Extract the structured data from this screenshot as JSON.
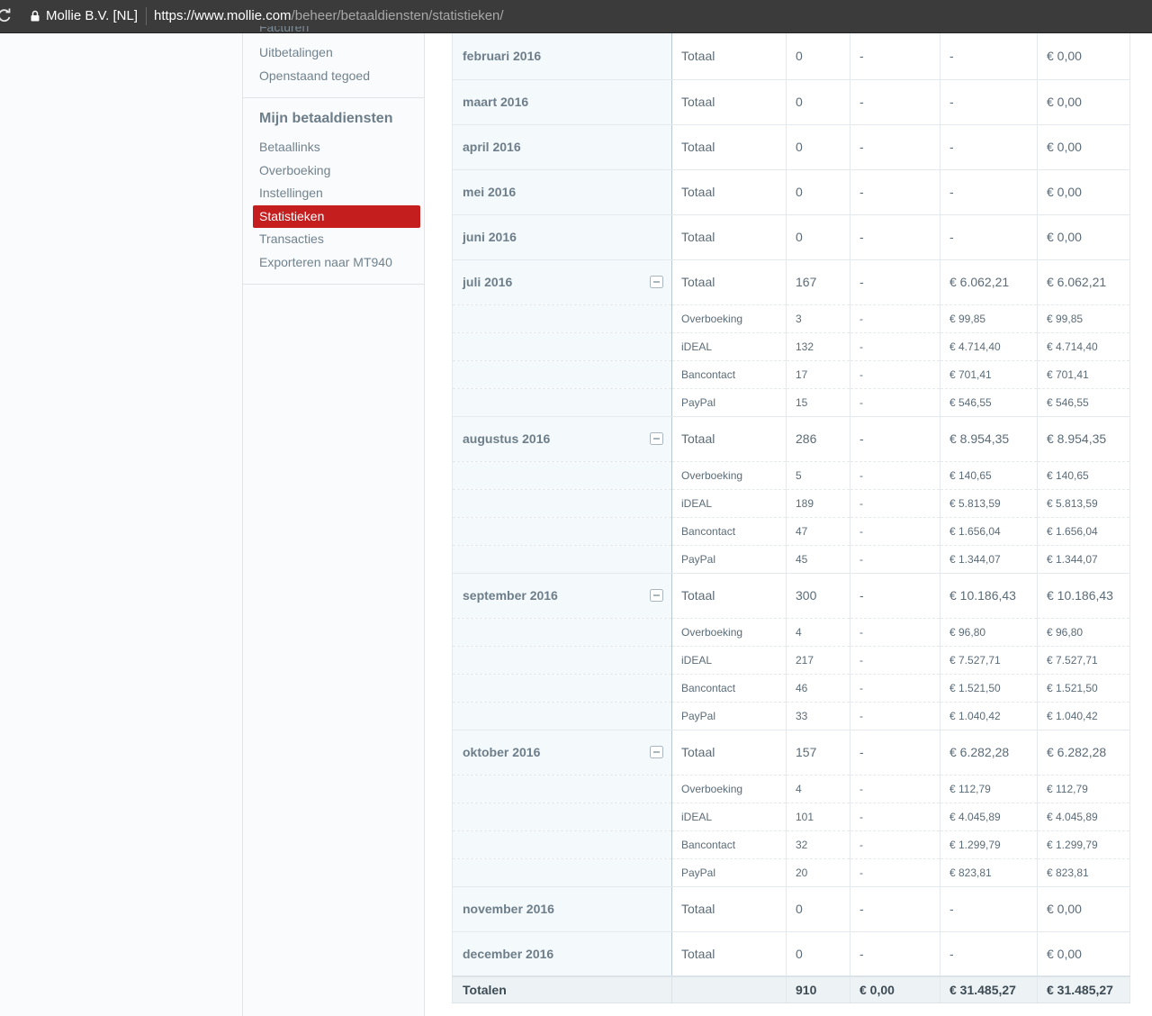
{
  "browser": {
    "site_identity": "Mollie B.V. [NL]",
    "url_scheme": "https://",
    "url_host": "www.mollie.com",
    "url_path": "/beheer/betaaldiensten/statistieken/"
  },
  "sidebar": {
    "clipped_item": "Facturen",
    "top_items": [
      {
        "label": "Uitbetalingen"
      },
      {
        "label": "Openstaand tegoed"
      }
    ],
    "section_heading": "Mijn betaaldiensten",
    "items": [
      {
        "label": "Betaallinks"
      },
      {
        "label": "Overboeking"
      },
      {
        "label": "Instellingen"
      },
      {
        "label": "Statistieken",
        "active": true
      },
      {
        "label": "Transacties"
      },
      {
        "label": "Exporteren naar MT940"
      }
    ]
  },
  "table": {
    "rows": [
      {
        "month": "februari 2016",
        "label": "Totaal",
        "count": "0",
        "extra": "-",
        "amount": "-",
        "total": "€ 0,00"
      },
      {
        "month": "maart 2016",
        "label": "Totaal",
        "count": "0",
        "extra": "-",
        "amount": "-",
        "total": "€ 0,00"
      },
      {
        "month": "april 2016",
        "label": "Totaal",
        "count": "0",
        "extra": "-",
        "amount": "-",
        "total": "€ 0,00"
      },
      {
        "month": "mei 2016",
        "label": "Totaal",
        "count": "0",
        "extra": "-",
        "amount": "-",
        "total": "€ 0,00"
      },
      {
        "month": "juni 2016",
        "label": "Totaal",
        "count": "0",
        "extra": "-",
        "amount": "-",
        "total": "€ 0,00"
      },
      {
        "month": "juli 2016",
        "label": "Totaal",
        "count": "167",
        "extra": "-",
        "amount": "€ 6.062,21",
        "total": "€ 6.062,21",
        "methods": [
          {
            "label": "Overboeking",
            "count": "3",
            "extra": "-",
            "amount": "€ 99,85",
            "total": "€ 99,85"
          },
          {
            "label": "iDEAL",
            "count": "132",
            "extra": "-",
            "amount": "€ 4.714,40",
            "total": "€ 4.714,40"
          },
          {
            "label": "Bancontact",
            "count": "17",
            "extra": "-",
            "amount": "€ 701,41",
            "total": "€ 701,41"
          },
          {
            "label": "PayPal",
            "count": "15",
            "extra": "-",
            "amount": "€ 546,55",
            "total": "€ 546,55"
          }
        ]
      },
      {
        "month": "augustus 2016",
        "label": "Totaal",
        "count": "286",
        "extra": "-",
        "amount": "€ 8.954,35",
        "total": "€ 8.954,35",
        "methods": [
          {
            "label": "Overboeking",
            "count": "5",
            "extra": "-",
            "amount": "€ 140,65",
            "total": "€ 140,65"
          },
          {
            "label": "iDEAL",
            "count": "189",
            "extra": "-",
            "amount": "€ 5.813,59",
            "total": "€ 5.813,59"
          },
          {
            "label": "Bancontact",
            "count": "47",
            "extra": "-",
            "amount": "€ 1.656,04",
            "total": "€ 1.656,04"
          },
          {
            "label": "PayPal",
            "count": "45",
            "extra": "-",
            "amount": "€ 1.344,07",
            "total": "€ 1.344,07"
          }
        ]
      },
      {
        "month": "september 2016",
        "label": "Totaal",
        "count": "300",
        "extra": "-",
        "amount": "€ 10.186,43",
        "total": "€ 10.186,43",
        "methods": [
          {
            "label": "Overboeking",
            "count": "4",
            "extra": "-",
            "amount": "€ 96,80",
            "total": "€ 96,80"
          },
          {
            "label": "iDEAL",
            "count": "217",
            "extra": "-",
            "amount": "€ 7.527,71",
            "total": "€ 7.527,71"
          },
          {
            "label": "Bancontact",
            "count": "46",
            "extra": "-",
            "amount": "€ 1.521,50",
            "total": "€ 1.521,50"
          },
          {
            "label": "PayPal",
            "count": "33",
            "extra": "-",
            "amount": "€ 1.040,42",
            "total": "€ 1.040,42"
          }
        ]
      },
      {
        "month": "oktober 2016",
        "label": "Totaal",
        "count": "157",
        "extra": "-",
        "amount": "€ 6.282,28",
        "total": "€ 6.282,28",
        "methods": [
          {
            "label": "Overboeking",
            "count": "4",
            "extra": "-",
            "amount": "€ 112,79",
            "total": "€ 112,79"
          },
          {
            "label": "iDEAL",
            "count": "101",
            "extra": "-",
            "amount": "€ 4.045,89",
            "total": "€ 4.045,89"
          },
          {
            "label": "Bancontact",
            "count": "32",
            "extra": "-",
            "amount": "€ 1.299,79",
            "total": "€ 1.299,79"
          },
          {
            "label": "PayPal",
            "count": "20",
            "extra": "-",
            "amount": "€ 823,81",
            "total": "€ 823,81"
          }
        ]
      },
      {
        "month": "november 2016",
        "label": "Totaal",
        "count": "0",
        "extra": "-",
        "amount": "-",
        "total": "€ 0,00"
      },
      {
        "month": "december 2016",
        "label": "Totaal",
        "count": "0",
        "extra": "-",
        "amount": "-",
        "total": "€ 0,00"
      }
    ],
    "totals": {
      "label": "Totalen",
      "count": "910",
      "extra": "€ 0,00",
      "amount": "€ 31.485,27",
      "total": "€ 31.485,27"
    }
  }
}
